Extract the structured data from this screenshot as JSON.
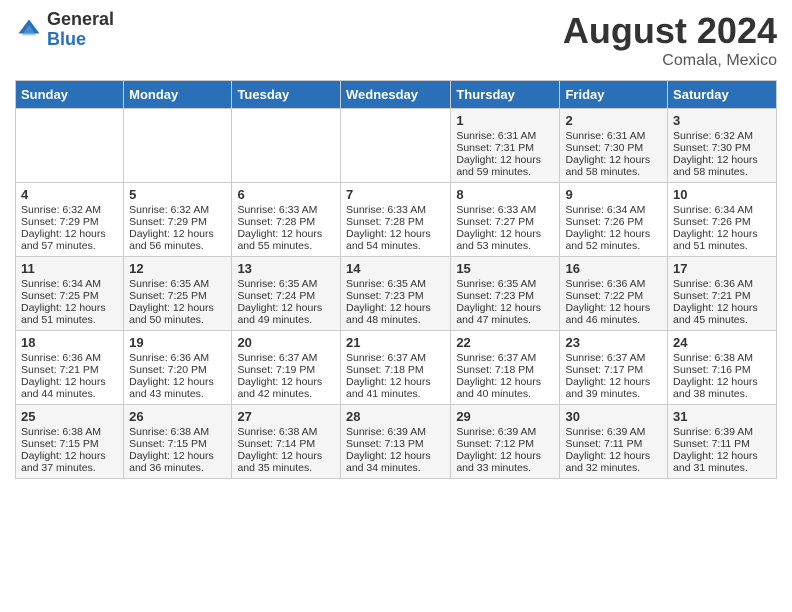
{
  "header": {
    "logo_general": "General",
    "logo_blue": "Blue",
    "month_year": "August 2024",
    "location": "Comala, Mexico"
  },
  "days_of_week": [
    "Sunday",
    "Monday",
    "Tuesday",
    "Wednesday",
    "Thursday",
    "Friday",
    "Saturday"
  ],
  "weeks": [
    [
      {
        "day": "",
        "info": ""
      },
      {
        "day": "",
        "info": ""
      },
      {
        "day": "",
        "info": ""
      },
      {
        "day": "",
        "info": ""
      },
      {
        "day": "1",
        "info": "Sunrise: 6:31 AM\nSunset: 7:31 PM\nDaylight: 12 hours\nand 59 minutes."
      },
      {
        "day": "2",
        "info": "Sunrise: 6:31 AM\nSunset: 7:30 PM\nDaylight: 12 hours\nand 58 minutes."
      },
      {
        "day": "3",
        "info": "Sunrise: 6:32 AM\nSunset: 7:30 PM\nDaylight: 12 hours\nand 58 minutes."
      }
    ],
    [
      {
        "day": "4",
        "info": "Sunrise: 6:32 AM\nSunset: 7:29 PM\nDaylight: 12 hours\nand 57 minutes."
      },
      {
        "day": "5",
        "info": "Sunrise: 6:32 AM\nSunset: 7:29 PM\nDaylight: 12 hours\nand 56 minutes."
      },
      {
        "day": "6",
        "info": "Sunrise: 6:33 AM\nSunset: 7:28 PM\nDaylight: 12 hours\nand 55 minutes."
      },
      {
        "day": "7",
        "info": "Sunrise: 6:33 AM\nSunset: 7:28 PM\nDaylight: 12 hours\nand 54 minutes."
      },
      {
        "day": "8",
        "info": "Sunrise: 6:33 AM\nSunset: 7:27 PM\nDaylight: 12 hours\nand 53 minutes."
      },
      {
        "day": "9",
        "info": "Sunrise: 6:34 AM\nSunset: 7:26 PM\nDaylight: 12 hours\nand 52 minutes."
      },
      {
        "day": "10",
        "info": "Sunrise: 6:34 AM\nSunset: 7:26 PM\nDaylight: 12 hours\nand 51 minutes."
      }
    ],
    [
      {
        "day": "11",
        "info": "Sunrise: 6:34 AM\nSunset: 7:25 PM\nDaylight: 12 hours\nand 51 minutes."
      },
      {
        "day": "12",
        "info": "Sunrise: 6:35 AM\nSunset: 7:25 PM\nDaylight: 12 hours\nand 50 minutes."
      },
      {
        "day": "13",
        "info": "Sunrise: 6:35 AM\nSunset: 7:24 PM\nDaylight: 12 hours\nand 49 minutes."
      },
      {
        "day": "14",
        "info": "Sunrise: 6:35 AM\nSunset: 7:23 PM\nDaylight: 12 hours\nand 48 minutes."
      },
      {
        "day": "15",
        "info": "Sunrise: 6:35 AM\nSunset: 7:23 PM\nDaylight: 12 hours\nand 47 minutes."
      },
      {
        "day": "16",
        "info": "Sunrise: 6:36 AM\nSunset: 7:22 PM\nDaylight: 12 hours\nand 46 minutes."
      },
      {
        "day": "17",
        "info": "Sunrise: 6:36 AM\nSunset: 7:21 PM\nDaylight: 12 hours\nand 45 minutes."
      }
    ],
    [
      {
        "day": "18",
        "info": "Sunrise: 6:36 AM\nSunset: 7:21 PM\nDaylight: 12 hours\nand 44 minutes."
      },
      {
        "day": "19",
        "info": "Sunrise: 6:36 AM\nSunset: 7:20 PM\nDaylight: 12 hours\nand 43 minutes."
      },
      {
        "day": "20",
        "info": "Sunrise: 6:37 AM\nSunset: 7:19 PM\nDaylight: 12 hours\nand 42 minutes."
      },
      {
        "day": "21",
        "info": "Sunrise: 6:37 AM\nSunset: 7:18 PM\nDaylight: 12 hours\nand 41 minutes."
      },
      {
        "day": "22",
        "info": "Sunrise: 6:37 AM\nSunset: 7:18 PM\nDaylight: 12 hours\nand 40 minutes."
      },
      {
        "day": "23",
        "info": "Sunrise: 6:37 AM\nSunset: 7:17 PM\nDaylight: 12 hours\nand 39 minutes."
      },
      {
        "day": "24",
        "info": "Sunrise: 6:38 AM\nSunset: 7:16 PM\nDaylight: 12 hours\nand 38 minutes."
      }
    ],
    [
      {
        "day": "25",
        "info": "Sunrise: 6:38 AM\nSunset: 7:15 PM\nDaylight: 12 hours\nand 37 minutes."
      },
      {
        "day": "26",
        "info": "Sunrise: 6:38 AM\nSunset: 7:15 PM\nDaylight: 12 hours\nand 36 minutes."
      },
      {
        "day": "27",
        "info": "Sunrise: 6:38 AM\nSunset: 7:14 PM\nDaylight: 12 hours\nand 35 minutes."
      },
      {
        "day": "28",
        "info": "Sunrise: 6:39 AM\nSunset: 7:13 PM\nDaylight: 12 hours\nand 34 minutes."
      },
      {
        "day": "29",
        "info": "Sunrise: 6:39 AM\nSunset: 7:12 PM\nDaylight: 12 hours\nand 33 minutes."
      },
      {
        "day": "30",
        "info": "Sunrise: 6:39 AM\nSunset: 7:11 PM\nDaylight: 12 hours\nand 32 minutes."
      },
      {
        "day": "31",
        "info": "Sunrise: 6:39 AM\nSunset: 7:11 PM\nDaylight: 12 hours\nand 31 minutes."
      }
    ]
  ]
}
